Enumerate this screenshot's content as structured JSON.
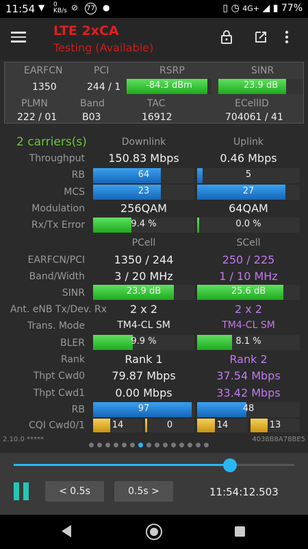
{
  "statusbar": {
    "time": "11:54",
    "data_rate": "0 KB/s",
    "notif_count": "77",
    "network": "4G+",
    "battery": "77%"
  },
  "appbar": {
    "title": "LTE 2xCA",
    "subtitle": "Testing (Available)"
  },
  "cell": {
    "headers": {
      "earfcn": "EARFCN",
      "pci": "PCI",
      "rsrp": "RSRP",
      "sinr": "SINR",
      "plmn": "PLMN",
      "band": "Band",
      "tac": "TAC",
      "ecellid": "ECellID"
    },
    "earfcn": "1350",
    "pci": "244 / 1",
    "rsrp": "-84.3 dBm",
    "rsrp_pct": 0.95,
    "sinr": "23.9 dB",
    "sinr_pct": 0.8,
    "plmn": "222 / 01",
    "band": "B03",
    "tac": "16912",
    "ecellid": "704061 / 41"
  },
  "carrier": {
    "summary": "2 carriers(s)",
    "col_downlink": "Downlink",
    "col_uplink": "Uplink",
    "throughput_label": "Throughput",
    "throughput_dl": "150.83 Mbps",
    "throughput_ul": "0.46 Mbps",
    "rb_label": "RB",
    "rb_dl": "64",
    "rb_dl_pct": 0.67,
    "rb_ul": "5",
    "rb_ul_pct": 0.05,
    "mcs_label": "MCS",
    "mcs_dl": "23",
    "mcs_dl_pct": 0.67,
    "mcs_ul": "27",
    "mcs_ul_pct": 0.86,
    "modulation_label": "Modulation",
    "modulation_dl": "256QAM",
    "modulation_ul": "64QAM",
    "error_label": "Rx/Tx Error",
    "error_dl": "9.4 %",
    "error_dl_pct": 0.38,
    "error_ul": "0.0 %",
    "error_ul_pct": 0.02
  },
  "cells": {
    "col_pcell": "PCell",
    "col_scell": "SCell",
    "earfcn_pci_label": "EARFCN/PCI",
    "earfcn_pci_p": "1350 / 244",
    "earfcn_pci_s": "250 / 225",
    "band_width_label": "Band/Width",
    "band_width_p": "3 / 20 MHz",
    "band_width_s": "1 / 10 MHz",
    "sinr_label": "SINR",
    "sinr_p": "23.9 dB",
    "sinr_p_pct": 0.8,
    "sinr_s": "25.6 dB",
    "sinr_s_pct": 0.84,
    "ant_label": "Ant. eNB Tx/Dev. Rx",
    "ant_p": "2 x 2",
    "ant_s": "2 x 2",
    "tm_label": "Trans. Mode",
    "tm_p": "TM4-CL SM",
    "tm_s": "TM4-CL SM",
    "bler_label": "BLER",
    "bler_p": "9.9 %",
    "bler_p_pct": 0.39,
    "bler_s": "8.1 %",
    "bler_s_pct": 0.34,
    "rank_label": "Rank",
    "rank_p": "Rank 1",
    "rank_s": "Rank 2",
    "cwd0_label": "Thpt Cwd0",
    "cwd0_p": "79.87 Mbps",
    "cwd0_s": "37.54 Mbps",
    "cwd1_label": "Thpt Cwd1",
    "cwd1_p": "0.00 Mbps",
    "cwd1_s": "33.42 Mbps",
    "rb_label": "RB",
    "rb_p": "97",
    "rb_p_pct": 0.97,
    "rb_s": "48",
    "rb_s_pct": 0.48,
    "cqi_label": "CQI Cwd0/1",
    "cqi_p0": "14",
    "cqi_p1": "0",
    "cqi_s0": "14",
    "cqi_s1": "13",
    "cqi_p0_pct": 0.35,
    "cqi_p1_pct": 0.04,
    "cqi_s0_pct": 0.35,
    "cqi_s1_pct": 0.35
  },
  "footer": {
    "version": "2.10.0 *****",
    "device_id": "4038B8A78BE5"
  },
  "player": {
    "progress": 0.77,
    "back_label": "< 0.5s",
    "forward_label": "0.5s >",
    "timestamp": "11:54:12.503"
  },
  "pager": {
    "count": 15,
    "active": 6
  },
  "colors": {
    "accent_title": "#e21f1f",
    "scell_text": "#c07af0",
    "slider": "#29b6f6"
  }
}
